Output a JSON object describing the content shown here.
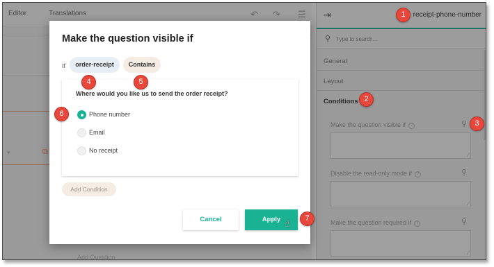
{
  "editor": {
    "tab_editor": "Editor",
    "tab_translations": "Translations",
    "add_question": "Add Question"
  },
  "property_panel": {
    "title": "receipt-phone-number",
    "search_placeholder": "Type to search...",
    "sections": [
      "General",
      "Layout",
      "Conditions"
    ],
    "active_section": "Conditions",
    "condition_fields": [
      {
        "label": "Make the question visible if"
      },
      {
        "label": "Disable the read-only mode if"
      },
      {
        "label": "Make the question required if"
      }
    ]
  },
  "modal": {
    "title": "Make the question visible if",
    "if_label": "If",
    "variable": "order-receipt",
    "operator": "Contains",
    "question": "Where would you like us to send the order receipt?",
    "options": [
      {
        "label": "Phone number",
        "checked": true
      },
      {
        "label": "Email",
        "checked": false
      },
      {
        "label": "No receipt",
        "checked": false
      }
    ],
    "add_condition": "Add Condition",
    "cancel": "Cancel",
    "apply": "Apply"
  },
  "callouts": [
    "1",
    "2",
    "3",
    "4",
    "5",
    "6",
    "7"
  ],
  "colors": {
    "accent": "#19b394",
    "callout": "#e8473c",
    "variable_pill": "#e8eef5",
    "operator_pill": "#f5ede4"
  },
  "icons": [
    "undo-icon",
    "redo-icon",
    "settings-icon",
    "collapse-panel-icon",
    "search-icon",
    "info-icon",
    "magic-wand-icon",
    "resize-handle-icon",
    "pointer-cursor-icon"
  ]
}
